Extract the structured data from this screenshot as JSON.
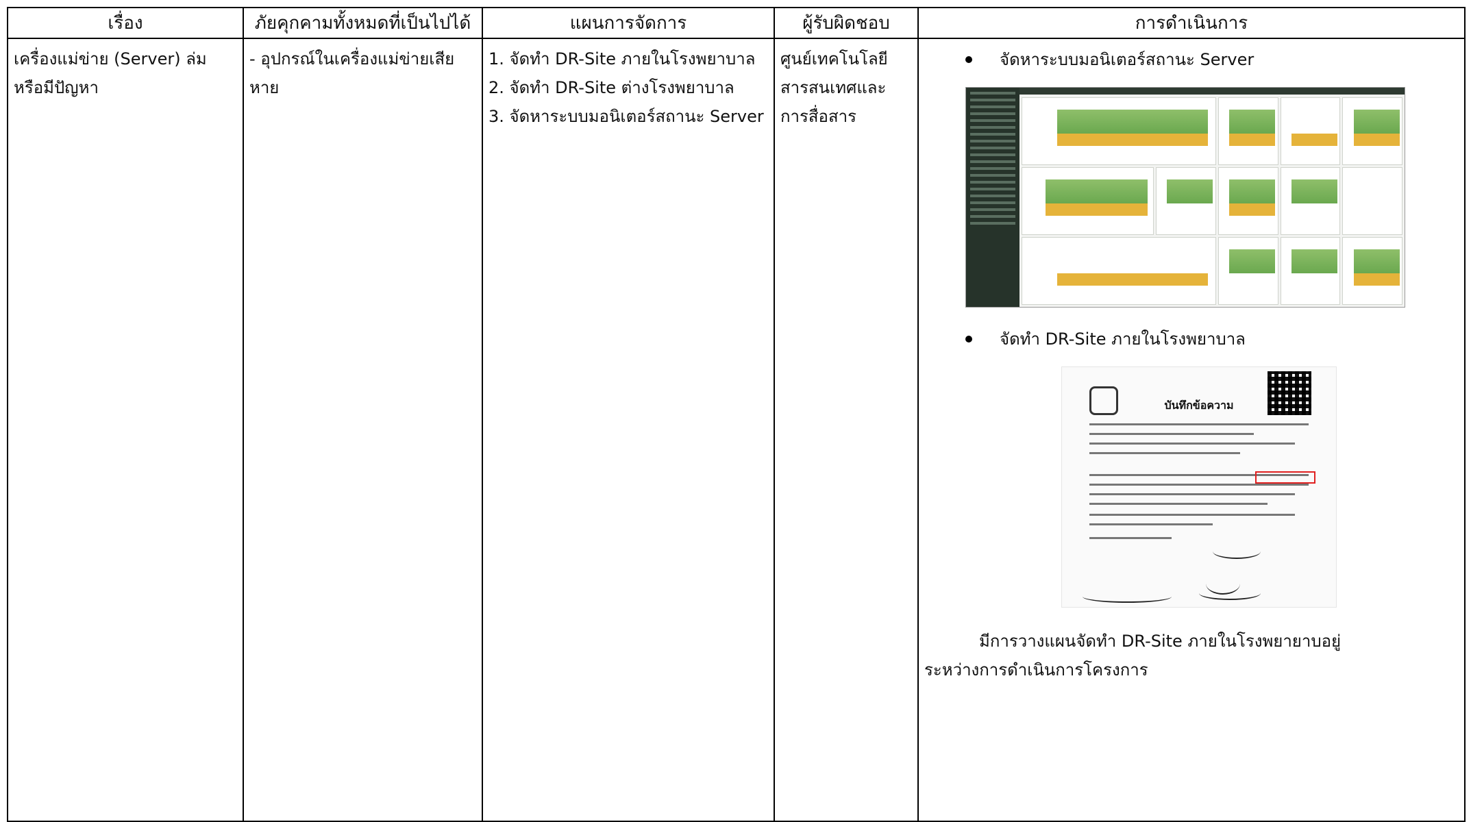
{
  "headers": [
    "เรื่อง",
    "ภัยคุกคามทั้งหมดที่เป็นไปได้",
    "แผนการจัดการ",
    "ผู้รับผิดชอบ",
    "การดำเนินการ"
  ],
  "row": {
    "topic": "เครื่องแม่ข่าย (Server) ล่ม หรือมีปัญหา",
    "threat": "- อุปกรณ์ในเครื่องแม่ข่ายเสียหาย",
    "plans": [
      "1. จัดทำ DR-Site ภายในโรงพยาบาล",
      "2. จัดทำ DR-Site ต่างโรงพยาบาล",
      "3. จัดหาระบบมอนิเตอร์สถานะ Server"
    ],
    "responsible": "ศูนย์เทคโนโลยีสารสนเทศและการสื่อสาร",
    "actions": {
      "bullet1": "จัดหาระบบมอนิเตอร์สถานะ Server",
      "bullet2": "จัดทำ DR-Site ภายในโรงพยาบาล",
      "memo_title": "บันทึกข้อความ",
      "note_line1": "มีการวางแผนจัดทำ DR-Site ภายในโรงพยายาบอยู่",
      "note_line2": "ระหว่างการดำเนินการโครงการ"
    }
  }
}
